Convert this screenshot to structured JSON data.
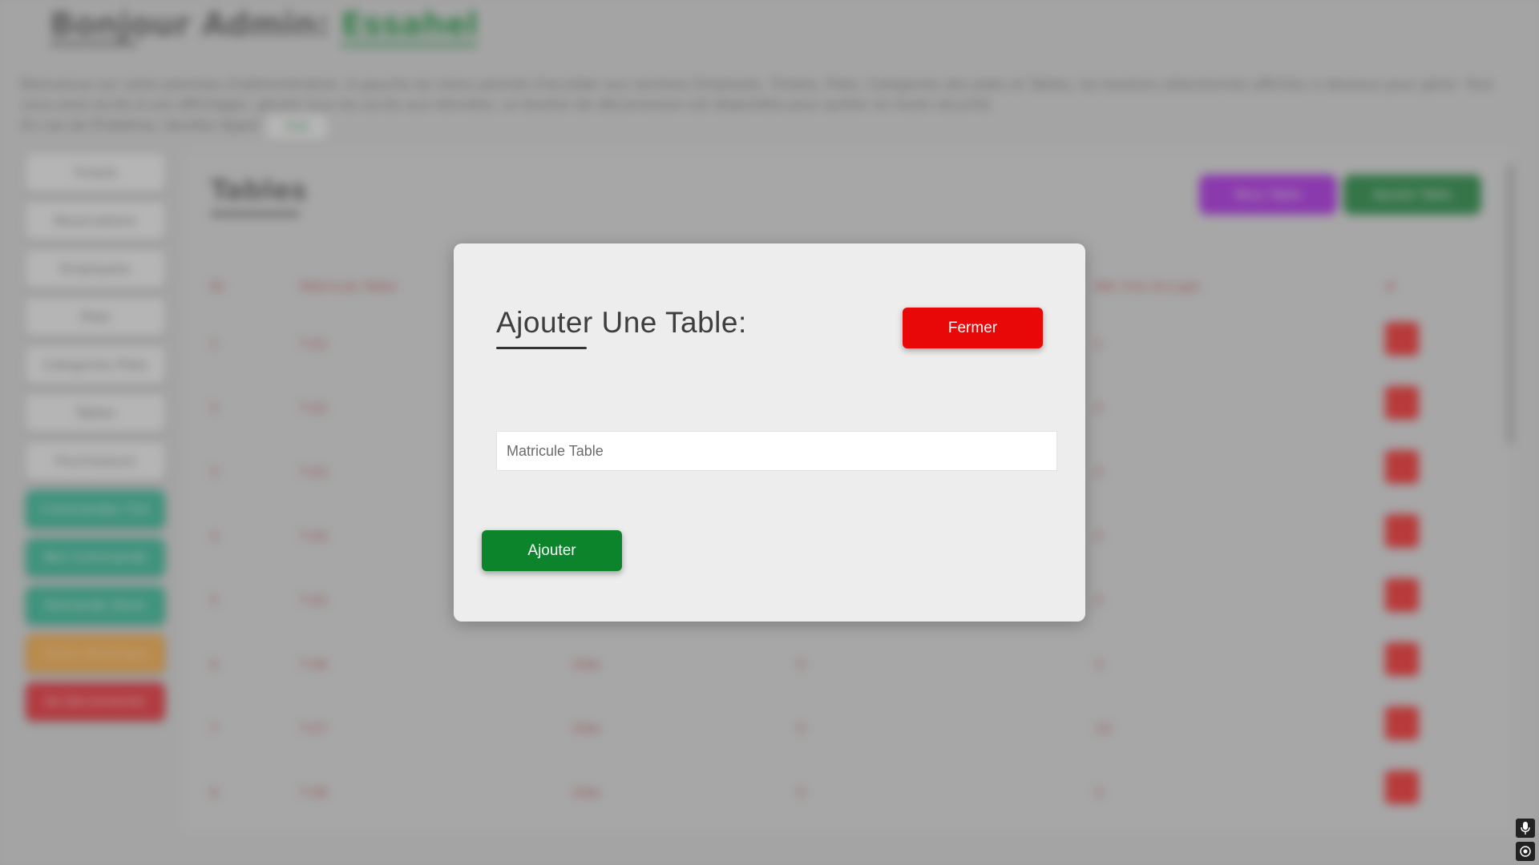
{
  "background": {
    "greeting": "Bonjour Admin:",
    "admin_name": "Essahel",
    "intro_text": "Bienvenue sur votre panneau d'administration. A gauche du menu permet d'accéder aux sections Employés, Tickets, Plats, Categories des plats et Tables, les boutons sélectionnés affichés ci-dessous pour gérer. Tout vous avez accès à vos affichages, gérant tous les accès aux données, un bouton de déconnexion est disponible pour quitter en toute sécurité.",
    "intro_text2": "En cas de Problème, Veuillez Appel",
    "intro_pill": "Aide",
    "sidebar": [
      {
        "label": "Tickets",
        "style": "default"
      },
      {
        "label": "Reservations",
        "style": "default"
      },
      {
        "label": "Employees",
        "style": "default"
      },
      {
        "label": "Plats",
        "style": "default"
      },
      {
        "label": "Categories Plats",
        "style": "default"
      },
      {
        "label": "Tables",
        "style": "default"
      },
      {
        "label": "Fournisseurs",
        "style": "default"
      },
      {
        "label": "Commandes Tick",
        "style": "green"
      },
      {
        "label": "Bon Commande",
        "style": "green"
      },
      {
        "label": "Demande Stock",
        "style": "green"
      },
      {
        "label": "Stock Historique",
        "style": "orange"
      },
      {
        "label": "Se Deconnecter",
        "style": "red"
      }
    ],
    "panel_title": "Tables",
    "top_buttons": [
      "Nouv Table",
      "Ajouter Table"
    ],
    "table_headers": [
      "ID",
      "Matricule Table",
      "Nbr Fois Occupé",
      "#"
    ],
    "table_rows": [
      {
        "id": "1",
        "mat": "T-01",
        "c3": "",
        "c4": "",
        "c5": "1"
      },
      {
        "id": "2",
        "mat": "T-02",
        "c3": "",
        "c4": "",
        "c5": "0"
      },
      {
        "id": "3",
        "mat": "T-03",
        "c3": "",
        "c4": "",
        "c5": "0"
      },
      {
        "id": "4",
        "mat": "T-04",
        "c3": "",
        "c4": "",
        "c5": "0"
      },
      {
        "id": "5",
        "mat": "T-05",
        "c3": "",
        "c4": "",
        "c5": "0"
      },
      {
        "id": "6",
        "mat": "T-06",
        "c3": "Vide",
        "c4": "0",
        "c5": "0"
      },
      {
        "id": "7",
        "mat": "T-07",
        "c3": "Vide",
        "c4": "0",
        "c5": "10"
      },
      {
        "id": "8",
        "mat": "T-08",
        "c3": "Vide",
        "c4": "0",
        "c5": "0"
      }
    ]
  },
  "modal": {
    "title": "Ajouter Une Table:",
    "close_label": "Fermer",
    "matricule_placeholder": "Matricule Table",
    "matricule_value": "",
    "submit_label": "Ajouter",
    "colors": {
      "close": "#e80808",
      "submit": "#0b842b"
    }
  },
  "corner_icons": [
    "microphone-icon",
    "location-target-icon"
  ]
}
